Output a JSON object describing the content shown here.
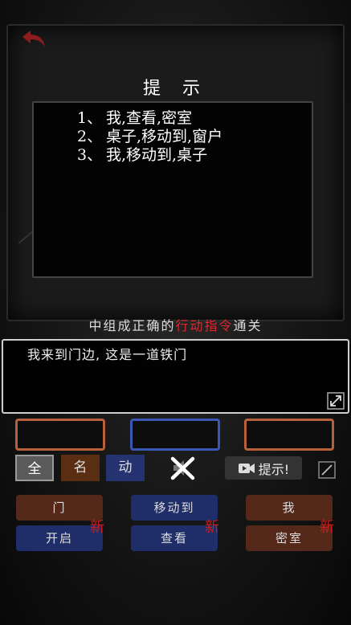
{
  "hint": {
    "title": "提 示",
    "items": [
      {
        "num": "1、",
        "text": "我,查看,密室"
      },
      {
        "num": "2、",
        "text": "桌子,移动到,窗户"
      },
      {
        "num": "3、",
        "text": "我,移动到,桌子"
      }
    ]
  },
  "subtitle": {
    "before": "中组成正确的",
    "highlight": "行动指令",
    "after": "通关"
  },
  "message": "我来到门边, 这是一道铁门",
  "filters": {
    "all": "全",
    "noun": "名",
    "verb": "动"
  },
  "hint_button": "提示!",
  "words": {
    "left_top": "门",
    "left_bottom": "开启",
    "mid_top": "移动到",
    "mid_bottom": "查看",
    "right_top": "我",
    "right_bottom": "密室"
  },
  "new_tag": "新",
  "colors": {
    "noun": "#55291a",
    "verb": "#1f2e68",
    "highlight": "#e2262e",
    "new": "#c81e1e"
  }
}
